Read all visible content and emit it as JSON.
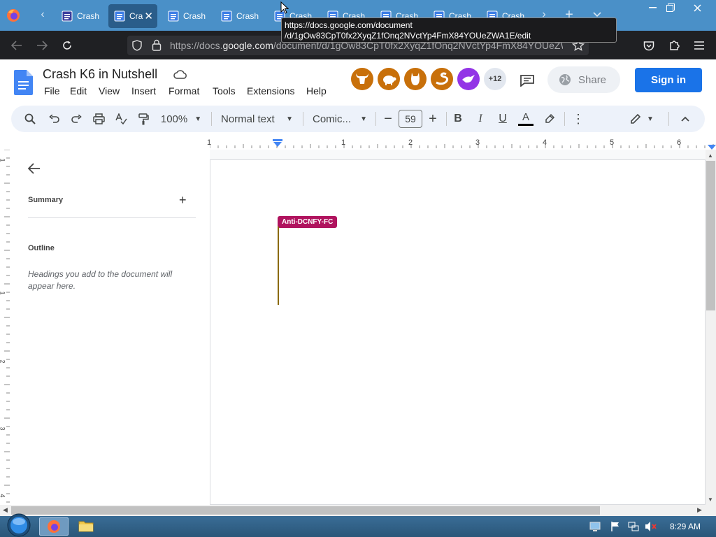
{
  "browser": {
    "tabs": [
      {
        "label": "Crash",
        "active": false,
        "close": ""
      },
      {
        "label": "Cra",
        "active": true,
        "close": "✕"
      },
      {
        "label": "Crash",
        "active": false,
        "close": ""
      },
      {
        "label": "Crash",
        "active": false,
        "close": ""
      },
      {
        "label": "Crash",
        "active": false,
        "close": ""
      },
      {
        "label": "Crash",
        "active": false,
        "close": ""
      },
      {
        "label": "Crash",
        "active": false,
        "close": ""
      },
      {
        "label": "Crash",
        "active": false,
        "close": ""
      },
      {
        "label": "Crash",
        "active": false,
        "close": ""
      }
    ],
    "url_prefix": "https://docs.",
    "url_host": "google.com",
    "url_rest": "/document/d/1gOw83CpT0fx2XyqZ1fOnq2NVctYp4FmX84YOUeZWA1E/edit",
    "tooltip_line1": "https://docs.google.com/document",
    "tooltip_line2": "/d/1gOw83CpT0fx2XyqZ1fOnq2NVctYp4FmX84YOUeZWA1E/edit"
  },
  "docs": {
    "title": "Crash K6 in Nutshell",
    "menu": [
      "File",
      "Edit",
      "View",
      "Insert",
      "Format",
      "Tools",
      "Extensions",
      "Help"
    ],
    "collaborator_count": "+12",
    "share_label": "Share",
    "signin_label": "Sign in"
  },
  "toolbar": {
    "zoom": "100%",
    "style": "Normal text",
    "font": "Comic...",
    "font_size": "59"
  },
  "ruler": {
    "h_labels": [
      "1",
      "1",
      "2",
      "3",
      "4",
      "5",
      "6"
    ],
    "v_labels": [
      "1",
      "1",
      "2",
      "3",
      "4"
    ]
  },
  "sidebar": {
    "summary_label": "Summary",
    "outline_label": "Outline",
    "outline_hint": "Headings you add to the document will appear here."
  },
  "document": {
    "collab_cursor_label": "Anti-DCNFY-FC",
    "collab_color": "#b0135e",
    "cursor_color": "#8a6a00"
  },
  "taskbar": {
    "clock": "8:29 AM"
  },
  "colors": {
    "accent": "#1a73e8",
    "tabbar": "#4a90c8",
    "avatar_orange": "#c8700a",
    "avatar_purple": "#9334e6"
  }
}
